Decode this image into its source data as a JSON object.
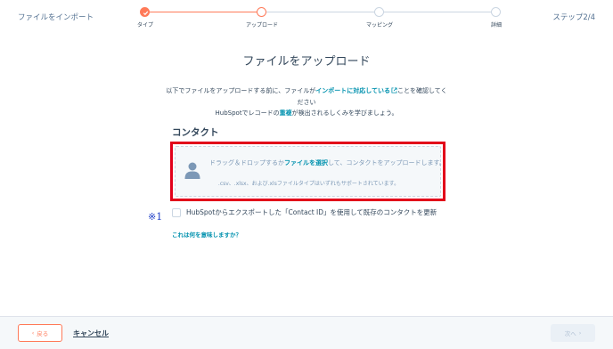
{
  "header": {
    "title": "ファイルをインポート",
    "step_indicator": "ステップ2/4"
  },
  "progress": {
    "steps": [
      {
        "label": "タイプ",
        "state": "done"
      },
      {
        "label": "アップロード",
        "state": "current"
      },
      {
        "label": "マッピング",
        "state": "todo"
      },
      {
        "label": "詳細",
        "state": "todo"
      }
    ]
  },
  "main": {
    "title": "ファイルをアップロード",
    "desc_part1": "以下でファイルをアップロードする前に、ファイルが",
    "desc_link1": "インポートに対応している",
    "desc_part2": "ことを確認してください",
    "desc_part3": "HubSpotでレコードの",
    "desc_link2": "重複",
    "desc_part4": "が検出されるしくみを学びましょう。",
    "section_title": "コンタクト",
    "dropzone": {
      "text_before": "ドラッグ＆ドロップするか",
      "link": "ファイルを選択",
      "text_after": "して、コンタクトをアップロードします。",
      "formats": ".csv、.xlsx、および.xlsファイルタイプはいずれもサポートされています。"
    },
    "note_mark": "※1",
    "checkbox_label": "HubSpotからエクスポートした「Contact ID」を使用して既存のコンタクトを更新",
    "help_link": "これは何を意味しますか？"
  },
  "footer": {
    "back_label": "戻る",
    "cancel_label": "キャンセル",
    "next_label": "次へ"
  },
  "colors": {
    "accent": "#ff7a59",
    "link": "#0091ae",
    "highlight": "#e2001a",
    "text": "#33475b"
  }
}
